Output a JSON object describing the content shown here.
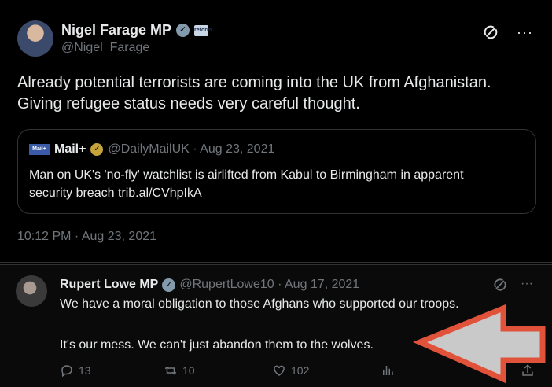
{
  "main_tweet": {
    "author_name": "Nigel Farage MP",
    "author_handle": "@Nigel_Farage",
    "badge_text": "reform",
    "text_line1": "Already potential terrorists are coming into the UK from Afghanistan.",
    "text_line2": "Giving refugee status needs very careful thought.",
    "timestamp": "10:12 PM · Aug 23, 2021"
  },
  "quoted_tweet": {
    "logo_text": "Mail+",
    "author_name": "Mail+",
    "meta": "@DailyMailUK · Aug 23, 2021",
    "text_line1": "Man on UK's 'no-fly' watchlist is airlifted from Kabul to Birmingham in apparent",
    "text_line2": "security breach trib.al/CVhpIkA"
  },
  "reply_tweet": {
    "author_name": "Rupert Lowe MP",
    "meta": "@RupertLowe10 · Aug 17, 2021",
    "text_line1": "We have a moral obligation to those Afghans who supported our troops.",
    "text_line2": "It's our mess. We can't just abandon them to the wolves.",
    "actions": {
      "replies": "13",
      "reposts": "10",
      "likes": "102"
    }
  },
  "icons": {
    "verified": "verified-badge-icon",
    "grok": "grok-icon",
    "more": "more-icon",
    "reply": "reply-icon",
    "repost": "repost-icon",
    "like": "like-icon",
    "views": "views-icon",
    "bookmark": "bookmark-icon",
    "share": "share-icon",
    "annotation": "red-arrow-icon"
  },
  "colors": {
    "background": "#000000",
    "text": "#e7e9ea",
    "muted": "#71767b",
    "border": "#2f3336",
    "verified_grey": "#829aab",
    "verified_gold": "#c6a43a",
    "annotation_arrow_stroke": "#e0523a",
    "annotation_arrow_fill": "#c9c9c9"
  }
}
